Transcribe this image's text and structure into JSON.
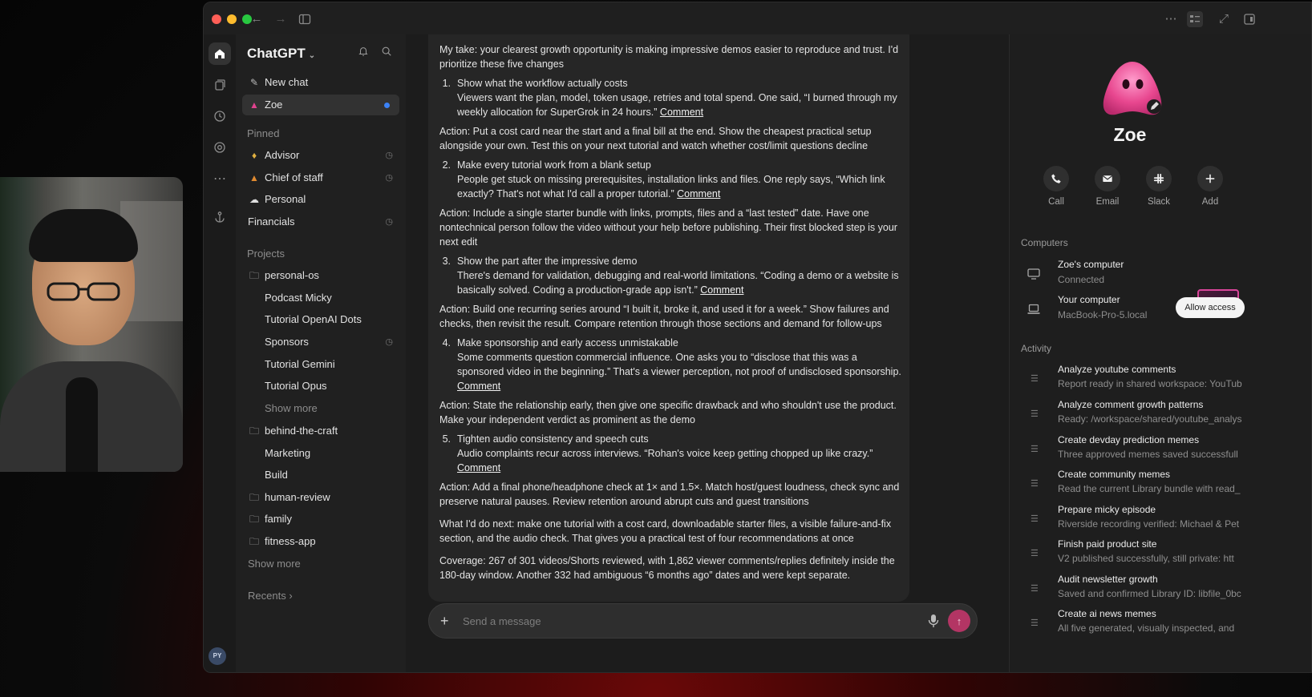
{
  "sidebar": {
    "app_title": "ChatGPT",
    "new_chat": "New chat",
    "active_chat": "Zoe",
    "pinned_header": "Pinned",
    "pinned": [
      "Advisor",
      "Chief of staff",
      "Personal",
      "Financials"
    ],
    "projects_header": "Projects",
    "projects": [
      {
        "label": "personal-os",
        "children": [
          "Podcast Micky",
          "Tutorial OpenAI Dots",
          "Sponsors",
          "Tutorial Gemini",
          "Tutorial Opus",
          "Show more"
        ]
      },
      {
        "label": "behind-the-craft",
        "children": [
          "Marketing",
          "Build"
        ]
      },
      {
        "label": "human-review",
        "children": []
      },
      {
        "label": "family",
        "children": []
      },
      {
        "label": "fitness-app",
        "children": []
      }
    ],
    "show_more": "Show more",
    "recents": "Recents",
    "user_initials": "PY"
  },
  "message": {
    "intro": "My take: your clearest growth opportunity is making impressive demos easier to reproduce and trust. I'd prioritize these five changes",
    "items": [
      {
        "num": "1.",
        "title": "Show what the workflow actually costs",
        "body": "Viewers want the plan, model, token usage, retries and total spend. One said, “I burned through my weekly allocation for SuperGrok in 24 hours.”",
        "link": "Comment",
        "action": "Action: Put a cost card near the start and a final bill at the end. Show the cheapest practical setup alongside your own. Test this on your next tutorial and watch whether cost/limit questions decline"
      },
      {
        "num": "2.",
        "title": "Make every tutorial work from a blank setup",
        "body": "People get stuck on missing prerequisites, installation links and files. One reply says, “Which link exactly? That's not what I'd call a proper tutorial.”",
        "link": "Comment",
        "action": "Action: Include a single starter bundle with links, prompts, files and a “last tested” date. Have one nontechnical person follow the video without your help before publishing. Their first blocked step is your next edit"
      },
      {
        "num": "3.",
        "title": "Show the part after the impressive demo",
        "body": "There's demand for validation, debugging and real-world limitations. “Coding a demo or a website is basically solved. Coding a production-grade app isn't.”",
        "link": "Comment",
        "action": "Action: Build one recurring series around “I built it, broke it, and used it for a week.” Show failures and checks, then revisit the result. Compare retention through those sections and demand for follow-ups"
      },
      {
        "num": "4.",
        "title": "Make sponsorship and early access unmistakable",
        "body": "Some comments question commercial influence. One asks you to “disclose that this was a sponsored video in the beginning.” That's a viewer perception, not proof of undisclosed sponsorship.",
        "link": "Comment",
        "action": "Action: State the relationship early, then give one specific drawback and who shouldn't use the product. Make your independent verdict as prominent as the demo"
      },
      {
        "num": "5.",
        "title": "Tighten audio consistency and speech cuts",
        "body": "Audio complaints recur across interviews. “Rohan's voice keep getting chopped up like crazy.”",
        "link": "Comment",
        "action": "Action: Add a final phone/headphone check at 1× and 1.5×. Match host/guest loudness, check sync and preserve natural pauses. Review retention around abrupt cuts and guest transitions"
      }
    ],
    "next": "What I'd do next: make one tutorial with a cost card, downloadable starter files, a visible failure-and-fix section, and the audio check. That gives you a practical test of four recommendations at once",
    "coverage": "Coverage: 267 of 301 videos/Shorts reviewed, with 1,862 viewer comments/replies definitely inside the 180-day window. Another 332 had ambiguous “6 months ago” dates and were kept separate."
  },
  "composer": {
    "placeholder": "Send a message"
  },
  "profile": {
    "name": "Zoe",
    "actions": [
      {
        "label": "Call",
        "icon": "phone-icon"
      },
      {
        "label": "Email",
        "icon": "email-icon"
      },
      {
        "label": "Slack",
        "icon": "slack-icon"
      },
      {
        "label": "Add",
        "icon": "plus-icon"
      }
    ],
    "computers_header": "Computers",
    "computers": [
      {
        "name": "Zoe's computer",
        "status": "Connected"
      },
      {
        "name": "Your computer",
        "status": "MacBook-Pro-5.local",
        "action": "Allow access"
      }
    ],
    "activity_header": "Activity",
    "activity": [
      {
        "title": "Analyze youtube comments",
        "detail": "Report ready in shared workspace: YouTub"
      },
      {
        "title": "Analyze comment growth patterns",
        "detail": "Ready: /workspace/shared/youtube_analys"
      },
      {
        "title": "Create devday prediction memes",
        "detail": "Three approved memes saved successfull"
      },
      {
        "title": "Create community memes",
        "detail": "Read the current Library bundle with read_"
      },
      {
        "title": "Prepare micky episode",
        "detail": "Riverside recording verified: Michael & Pet"
      },
      {
        "title": "Finish paid product site",
        "detail": "V2 published successfully, still private: htt"
      },
      {
        "title": "Audit newsletter growth",
        "detail": "Saved and confirmed Library ID: libfile_0bc"
      },
      {
        "title": "Create ai news memes",
        "detail": "All five generated, visually inspected, and"
      }
    ]
  },
  "colors": {
    "accent_pink": "#e0438f",
    "unread_dot": "#3b82f6",
    "send_button": "#b33564"
  }
}
